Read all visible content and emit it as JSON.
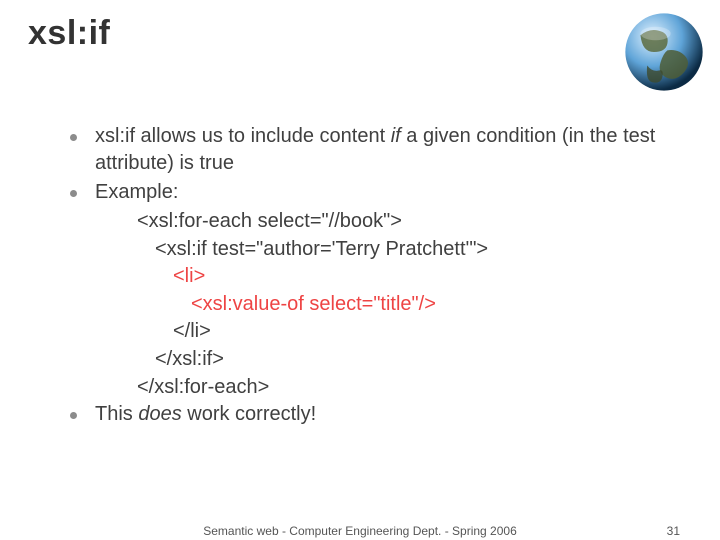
{
  "title": "xsl:if",
  "bullets": {
    "b1_pre": "xsl:if",
    "b1_mid": " allows us to include content ",
    "b1_if": "if",
    "b1_post1": " a given condition (in the ",
    "b1_test": "test",
    "b1_post2": " attribute) is true",
    "b2": "Example:",
    "b3_pre": "This ",
    "b3_does": "does",
    "b3_post": " work correctly!"
  },
  "code": {
    "l1": "<xsl:for-each  select=\"//book\">",
    "l2": "<xsl:if  test=\"author='Terry Pratchett'\">",
    "l3": "<li>",
    "l4": "<xsl:value-of  select=\"title\"/>",
    "l5": "</li>",
    "l6": "</xsl:if>",
    "l7": "</xsl:for-each>"
  },
  "footer": {
    "text": "Semantic web - Computer Engineering Dept. - Spring 2006",
    "page": "31"
  },
  "globe": {
    "name": "earth-globe-icon"
  }
}
